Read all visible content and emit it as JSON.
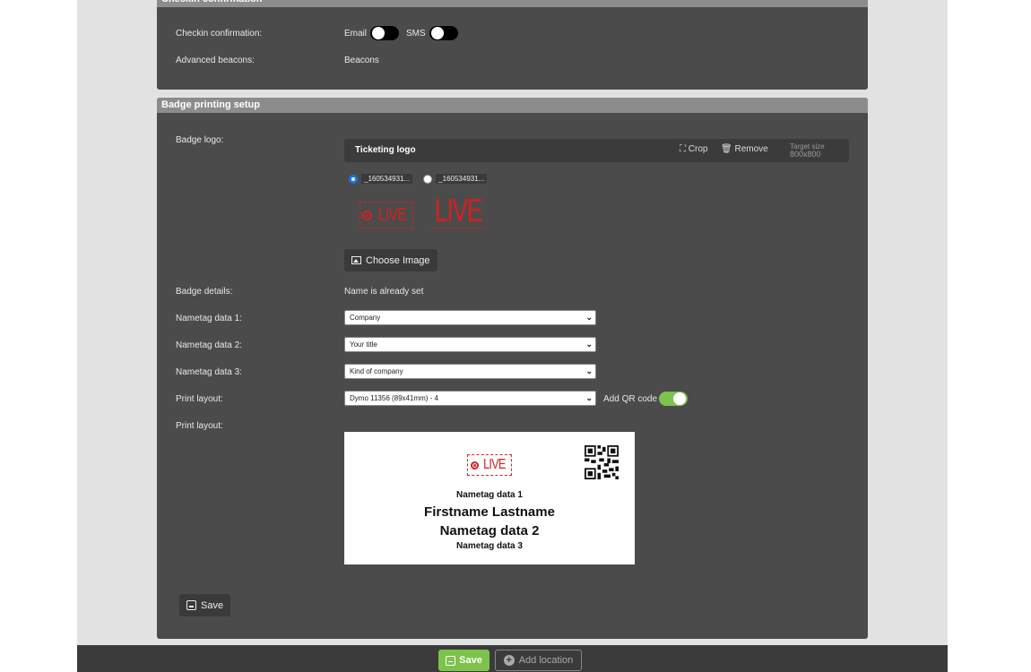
{
  "checkin_panel": {
    "title": "Checkin confirmation",
    "confirmation_label": "Checkin confirmation:",
    "email_label": "Email",
    "sms_label": "SMS",
    "email_on": false,
    "sms_on": false,
    "beacons_label": "Advanced beacons:",
    "beacons_value": "Beacons"
  },
  "badge_panel": {
    "title": "Badge printing setup",
    "logo_label": "Badge logo:",
    "logo_bar_title": "Ticketing logo",
    "crop_label": "Crop",
    "remove_label": "Remove",
    "target_size_label": "Target size",
    "target_size_value": "800x800",
    "files": [
      {
        "name": "_160534931...",
        "selected": true
      },
      {
        "name": "_160534931...",
        "selected": false
      }
    ],
    "logo_text_1": "LIVE",
    "logo_text_2": "LIVE",
    "choose_image_label": "Choose Image",
    "details_label": "Badge details:",
    "details_value": "Name is already set",
    "nametag1_label": "Nametag data 1:",
    "nametag1_value": "Company",
    "nametag2_label": "Nametag data 2:",
    "nametag2_value": "Your title",
    "nametag3_label": "Nametag data 3:",
    "nametag3_value": "Kind of company",
    "print_layout_label": "Print layout:",
    "print_layout_value": "Dymo 11356 (89x41mm) - 4",
    "qr_label": "Add QR code",
    "qr_on": true,
    "preview_label": "Print layout:",
    "preview": {
      "logo_text": "LIVE",
      "line1": "Nametag data 1",
      "name": "Firstname Lastname",
      "line2": "Nametag data 2",
      "line3": "Nametag data 3"
    },
    "save_label": "Save"
  },
  "footer": {
    "save_label": "Save",
    "add_location_label": "Add location"
  },
  "colors": {
    "panel_bg": "#4b4b4b",
    "header_bg": "#8c8c8c",
    "accent_green": "#7cc24b",
    "logo_red": "#d42020"
  }
}
